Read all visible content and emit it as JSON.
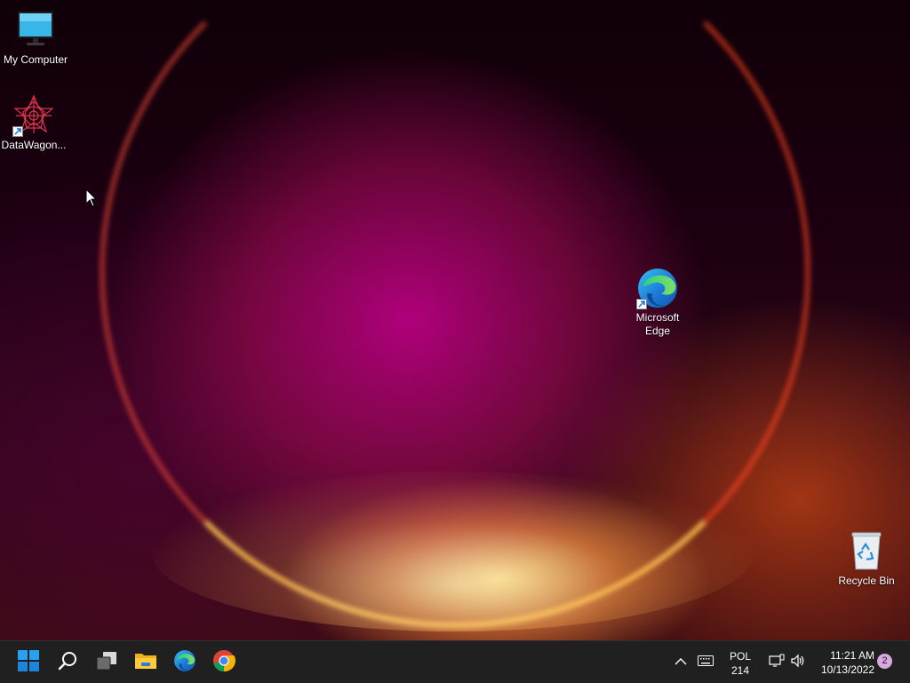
{
  "desktop": {
    "icons": [
      {
        "label": "My Computer",
        "icon": "monitor-icon"
      },
      {
        "label": "DataWagon...",
        "icon": "datawagon-icon",
        "shortcut": true
      },
      {
        "label": "Microsoft\nEdge",
        "icon": "edge-icon",
        "shortcut": true
      },
      {
        "label": "Recycle Bin",
        "icon": "recycle-bin-icon"
      }
    ]
  },
  "taskbar": {
    "apps": [
      {
        "name": "Start",
        "icon": "windows-start-icon"
      },
      {
        "name": "Search",
        "icon": "search-icon"
      },
      {
        "name": "Task View",
        "icon": "task-view-icon"
      },
      {
        "name": "File Explorer",
        "icon": "folder-icon"
      },
      {
        "name": "Microsoft Edge",
        "icon": "edge-icon"
      },
      {
        "name": "Google Chrome",
        "icon": "chrome-icon"
      }
    ],
    "tray": {
      "show_hidden_icon": "chevron-up-icon",
      "keyboard_icon": "keyboard-icon",
      "language": "POL",
      "language_sub": "214",
      "network_icon": "network-icon",
      "volume_icon": "volume-icon",
      "time": "11:21 AM",
      "date": "10/13/2022",
      "notification_count": "2"
    }
  },
  "colors": {
    "taskbar_bg": "#202020",
    "accent_blue": "#0078d4",
    "badge_bg": "#d8a7e0"
  }
}
